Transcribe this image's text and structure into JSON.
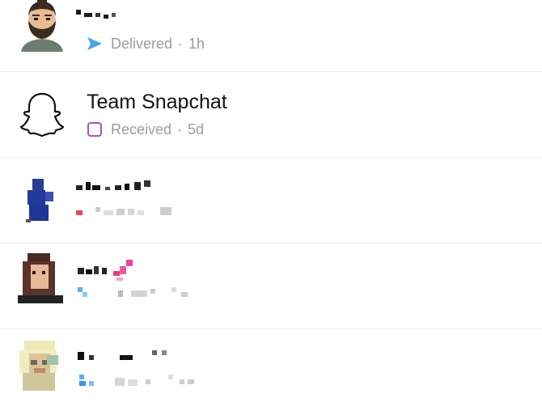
{
  "conversations": [
    {
      "name_redacted": true,
      "status": "Delivered",
      "separator": "·",
      "time": "1h",
      "status_icon": "sent-arrow-icon",
      "status_color": "#4aa3e8"
    },
    {
      "name": "Team Snapchat",
      "status": "Received",
      "separator": "·",
      "time": "5d",
      "status_icon": "received-square-icon",
      "status_color": "#9b59b6"
    },
    {
      "name_redacted": true,
      "status_redacted": true
    },
    {
      "name_redacted": true,
      "status_redacted": true
    },
    {
      "name_redacted": true,
      "status_redacted": true
    }
  ],
  "colors": {
    "divider": "#ececec",
    "secondary_text": "#9b9b9b",
    "primary_text": "#111111"
  }
}
